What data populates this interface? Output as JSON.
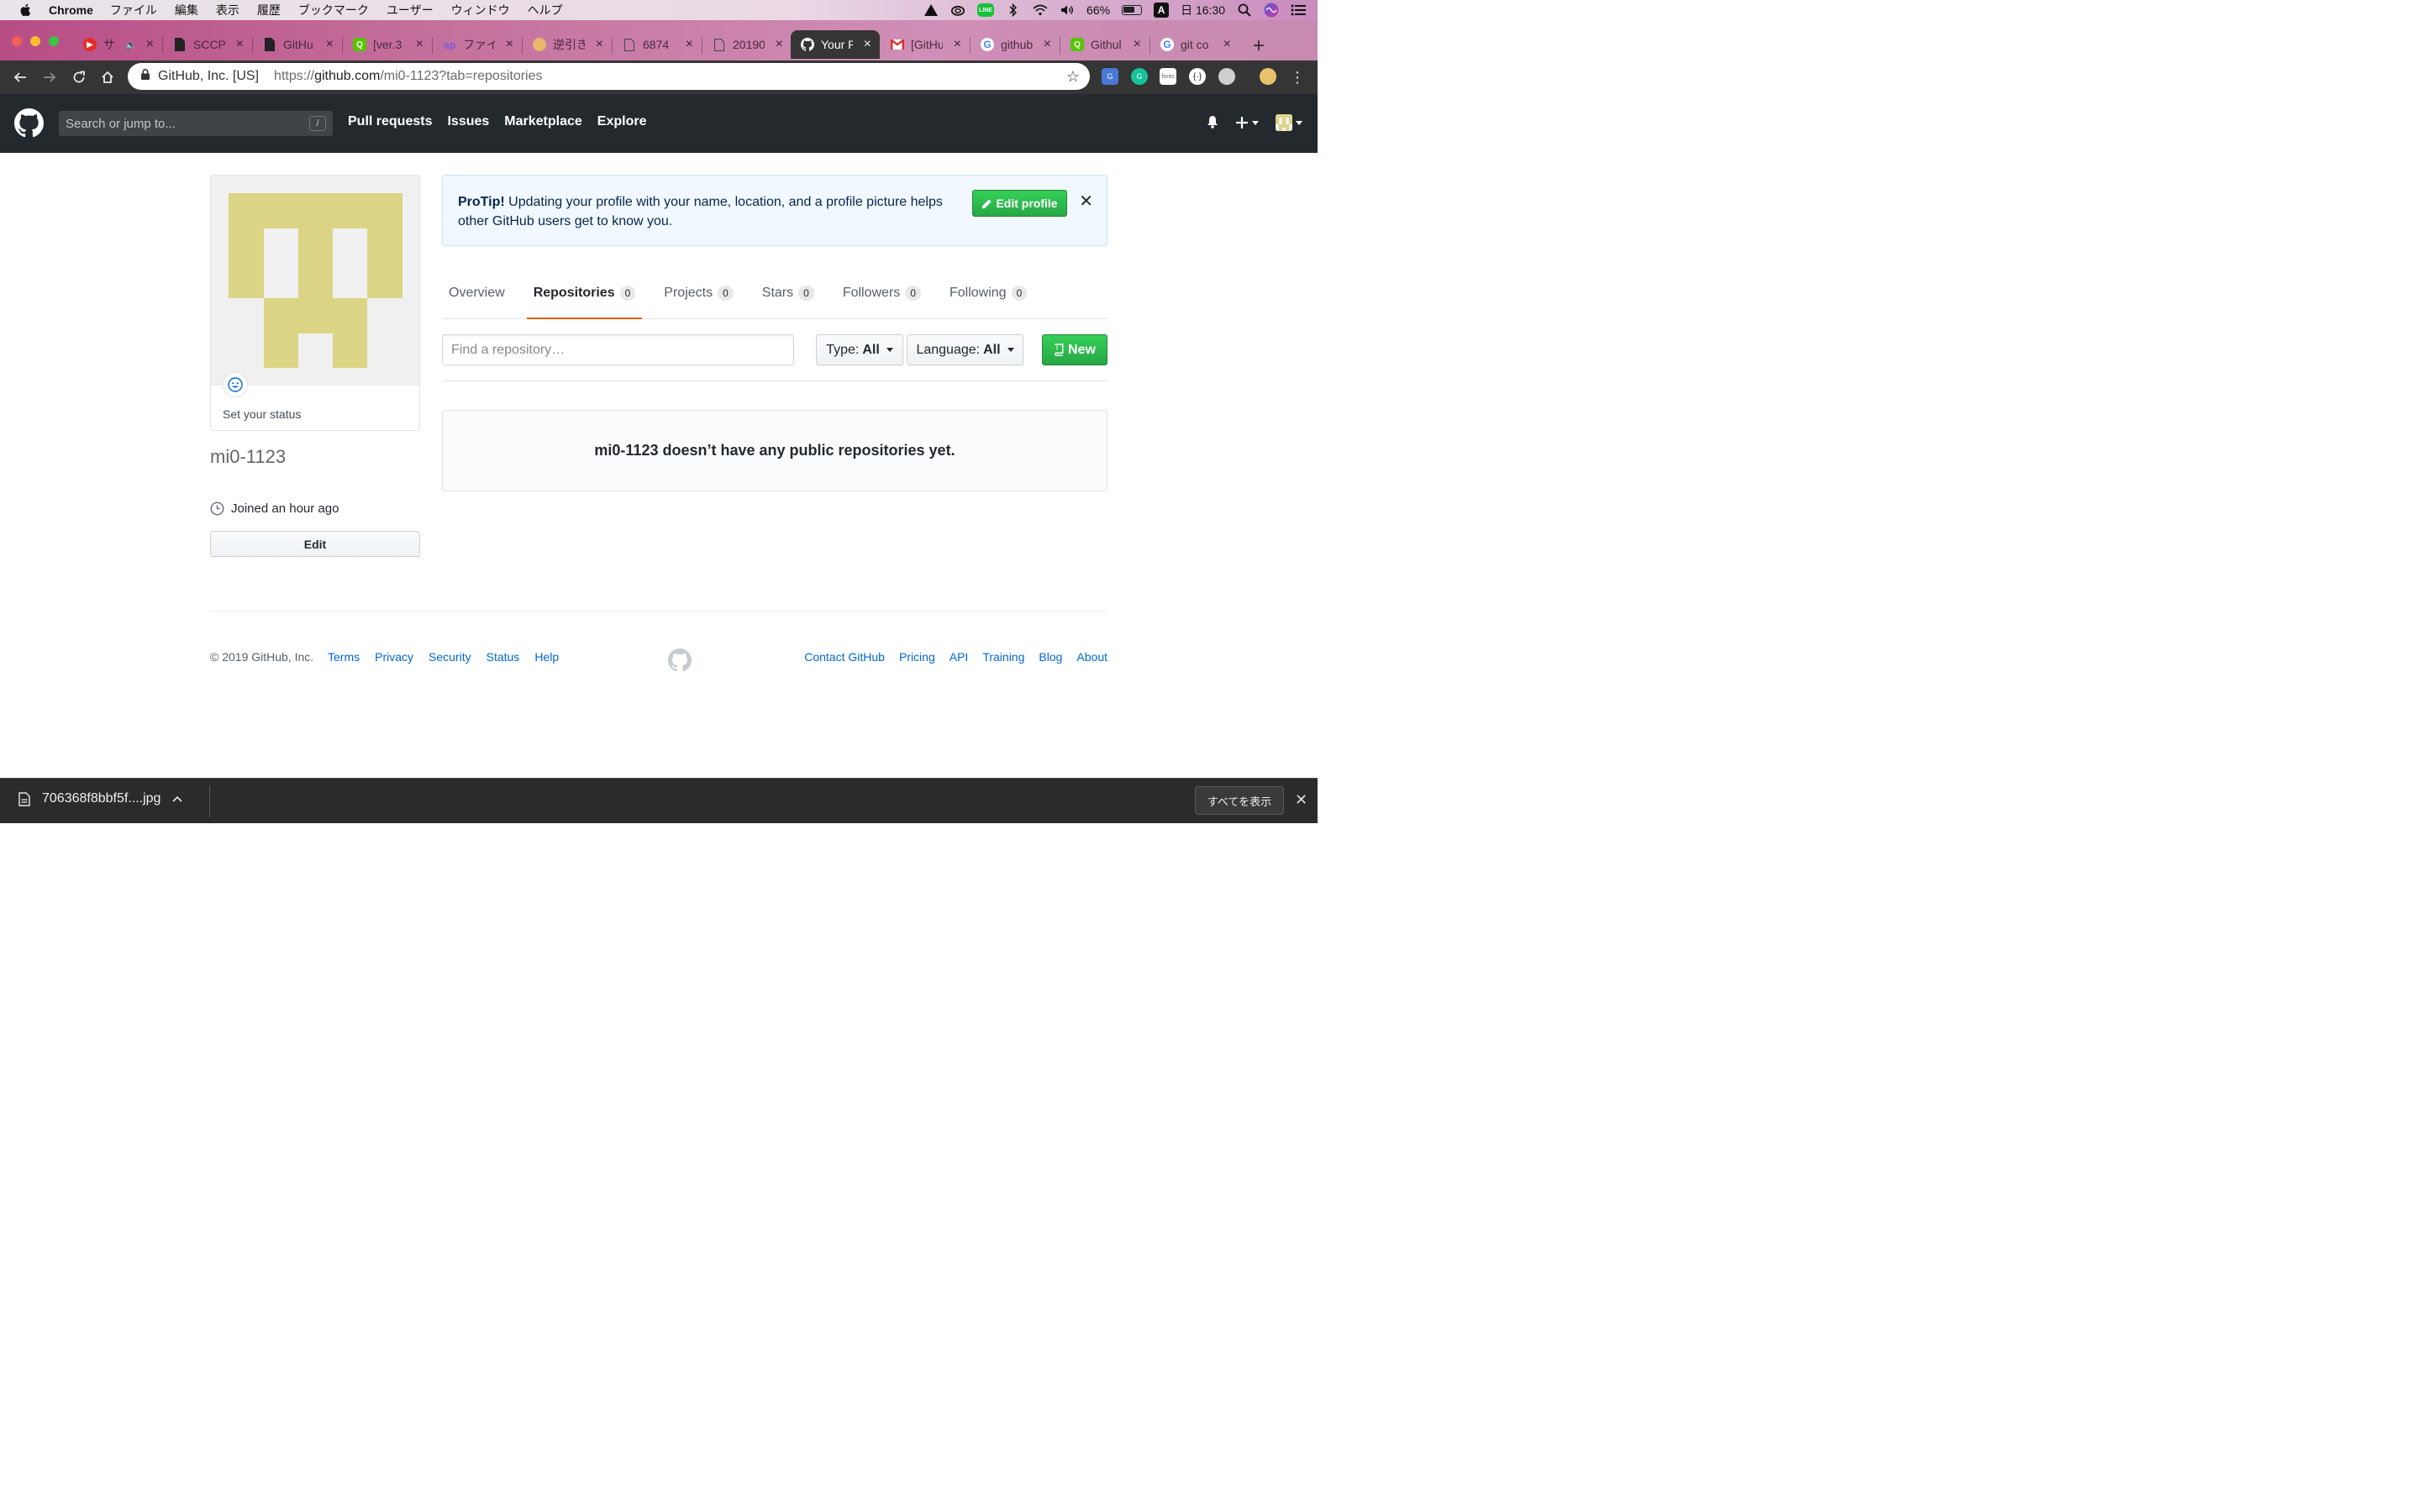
{
  "menubar": {
    "app_name": "Chrome",
    "items": [
      "ファイル",
      "編集",
      "表示",
      "履歴",
      "ブックマーク",
      "ユーザー",
      "ウィンドウ",
      "ヘルプ"
    ],
    "line_badge": "LINE",
    "battery_percent": "66%",
    "ime": "A",
    "clock": "日 16:30"
  },
  "tabs": [
    {
      "title": "サ",
      "favicon": "youtube-icon",
      "color": "#e52d27"
    },
    {
      "title": "SCCP",
      "favicon": "document-icon",
      "color": "#222222"
    },
    {
      "title": "GitHu",
      "favicon": "document-icon",
      "color": "#222222"
    },
    {
      "title": "[ver.3",
      "favicon": "qiita-icon",
      "color": "#55c500"
    },
    {
      "title": "ファイ",
      "favicon": "ap-icon",
      "color": "#7b5cd6"
    },
    {
      "title": "逆引き",
      "favicon": "hand-icon",
      "color": "#d9a35b"
    },
    {
      "title": "6874",
      "favicon": "page-icon",
      "color": "#555555"
    },
    {
      "title": "20190",
      "favicon": "page-icon",
      "color": "#555555"
    },
    {
      "title": "Your P",
      "favicon": "github-icon",
      "color": "#ffffff",
      "active": true
    },
    {
      "title": "[GitHu",
      "favicon": "gmail-icon",
      "color": "#d93025"
    },
    {
      "title": "github",
      "favicon": "google-icon",
      "color": "#4285f4"
    },
    {
      "title": "Githul",
      "favicon": "qiita-icon",
      "color": "#55c500"
    },
    {
      "title": "git co",
      "favicon": "google-icon",
      "color": "#4285f4"
    }
  ],
  "omnibox": {
    "org": "GitHub, Inc. [US]",
    "url_scheme": "https://",
    "url_host": "github.com",
    "url_path": "/mi0-1123?tab=repositories"
  },
  "extensions": [
    "translate-icon",
    "grammarly-icon",
    "fonts-icon",
    "code-icon",
    "ghost-icon",
    "avatar-icon"
  ],
  "extension_fonts_label": "fonts",
  "gh_header": {
    "search_placeholder": "Search or jump to...",
    "search_key": "/",
    "nav": [
      "Pull requests",
      "Issues",
      "Marketplace",
      "Explore"
    ]
  },
  "profile": {
    "set_status": "Set your status",
    "username": "mi0-1123",
    "joined": "Joined an hour ago",
    "edit_label": "Edit",
    "identicon_color": "#dcd485"
  },
  "protip": {
    "lead": "ProTip!",
    "text": " Updating your profile with your name, location, and a profile picture helps other GitHub users get to know you.",
    "button": "Edit profile",
    "close": "✕"
  },
  "profile_tabs": [
    {
      "label": "Overview",
      "count": null
    },
    {
      "label": "Repositories",
      "count": "0",
      "active": true
    },
    {
      "label": "Projects",
      "count": "0"
    },
    {
      "label": "Stars",
      "count": "0"
    },
    {
      "label": "Followers",
      "count": "0"
    },
    {
      "label": "Following",
      "count": "0"
    }
  ],
  "filters": {
    "find_placeholder": "Find a repository…",
    "type_label": "Type:",
    "type_value": "All",
    "language_label": "Language:",
    "language_value": "All",
    "new_label": "New"
  },
  "blankslate": "mi0-1123 doesn’t have any public repositories yet.",
  "footer": {
    "copyright": "© 2019 GitHub, Inc.",
    "left_links": [
      "Terms",
      "Privacy",
      "Security",
      "Status",
      "Help"
    ],
    "right_links": [
      "Contact GitHub",
      "Pricing",
      "API",
      "Training",
      "Blog",
      "About"
    ]
  },
  "downloads": {
    "filename": "706368f8bbf5f....jpg",
    "show_all": "すべてを表示"
  }
}
